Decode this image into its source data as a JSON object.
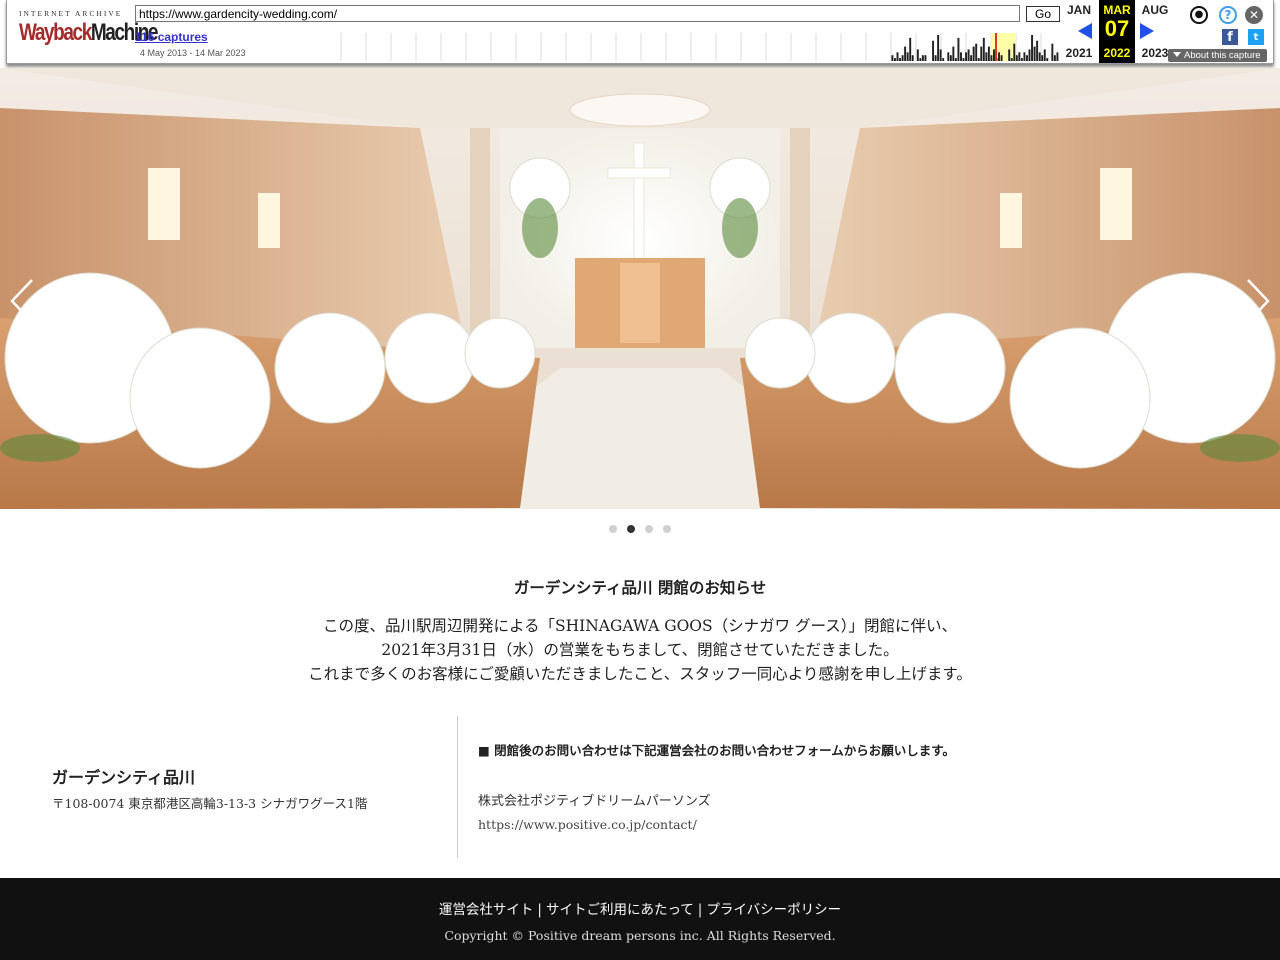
{
  "wayback": {
    "logo_top": "INTERNET ARCHIVE",
    "logo_wayback": "Wayback",
    "logo_machine": "Machine",
    "url": "https://www.gardencity-wedding.com/",
    "go_label": "Go",
    "captures": "116 captures",
    "range": "4 May 2013 - 14 Mar 2023",
    "prev": {
      "month": "JAN",
      "year": "2021"
    },
    "current": {
      "month": "MAR",
      "day": "07",
      "year": "2022"
    },
    "next": {
      "month": "AUG",
      "year": "2023"
    },
    "about": "About this capture",
    "sparkline": [
      0,
      0,
      0,
      0,
      0,
      0,
      0,
      0,
      0,
      0,
      0,
      0,
      0,
      0,
      0,
      0,
      0,
      0,
      0,
      0,
      0,
      0,
      0,
      0,
      0,
      0,
      0,
      0,
      0,
      0,
      0,
      0,
      0,
      0,
      0,
      0,
      0,
      0,
      0,
      0,
      0,
      0,
      0,
      0,
      0,
      0,
      0,
      0,
      0,
      0,
      0,
      0,
      0,
      0,
      0,
      0,
      0,
      0,
      0,
      0,
      0,
      0,
      0,
      0,
      0,
      0,
      0,
      0,
      0,
      0,
      0,
      0,
      0,
      0,
      0,
      0,
      0,
      0,
      0,
      0,
      0,
      0,
      0,
      0,
      0,
      0,
      0,
      0,
      0,
      0,
      0,
      0,
      0,
      0,
      0,
      0,
      0,
      0,
      0,
      0,
      0,
      0,
      0,
      0,
      0,
      0,
      0,
      0,
      0,
      0,
      0,
      0,
      0,
      0,
      0,
      0,
      0,
      0,
      0,
      0,
      0,
      0,
      0,
      0,
      0,
      0,
      0,
      0,
      0,
      0,
      0,
      0,
      0,
      0,
      0,
      0,
      0,
      0,
      0,
      0,
      0,
      0,
      0,
      0,
      0,
      0,
      0,
      0,
      0,
      0,
      0,
      0,
      0,
      0,
      0,
      0,
      0,
      0,
      0,
      0,
      0,
      0,
      0,
      0,
      0,
      0,
      0,
      0,
      0,
      0,
      0,
      0,
      0,
      0,
      0,
      0,
      0,
      0,
      0,
      0,
      0,
      0,
      0,
      0,
      0,
      0,
      0,
      0,
      0,
      0,
      0,
      0,
      0,
      0,
      0,
      0,
      0,
      0,
      0,
      0,
      0,
      0,
      0,
      0,
      0,
      0,
      0,
      0,
      0,
      0,
      0,
      0,
      0,
      0,
      0,
      0,
      0,
      0,
      0,
      0,
      2,
      1,
      3,
      1,
      2,
      5,
      3,
      8,
      2,
      0,
      4,
      1,
      2,
      2,
      0,
      0,
      7,
      2,
      9,
      4,
      1,
      0,
      3,
      2,
      5,
      1,
      8,
      3,
      1,
      3,
      4,
      2,
      5,
      6,
      1,
      5,
      8,
      3,
      5,
      2,
      4,
      1,
      3,
      2,
      0,
      0,
      4,
      1,
      6,
      2,
      3,
      1,
      3,
      2,
      4,
      9,
      5,
      7,
      3,
      2,
      4,
      1,
      0,
      6,
      2,
      3
    ]
  },
  "slider": {
    "total": 4,
    "active": 1
  },
  "notice": {
    "title": "ガーデンシティ品川 閉館のお知らせ",
    "lines": [
      "この度、品川駅周辺開発による「SHINAGAWA GOOS（シナガワ グース）」閉館に伴い、",
      "2021年3月31日（水）の営業をもちまして、閉館させていただきました。",
      "これまで多くのお客様にご愛顧いただきましたこと、スタッフ一同心より感謝を申し上げます。"
    ]
  },
  "venue": {
    "name": "ガーデンシティ品川",
    "address": "〒108-0074 東京都港区高輪3-13-3 シナガワグース1階"
  },
  "contact": {
    "heading": "■ 閉館後のお問い合わせは下記運営会社のお問い合わせフォームからお願いします。",
    "company": "株式会社ポジティブドリームパーソンズ",
    "url": "https://www.positive.co.jp/contact/"
  },
  "footer": {
    "links": [
      "運営会社サイト",
      "サイトご利用にあたって",
      "プライバシーポリシー"
    ],
    "separator": "|",
    "copyright": "Copyright © Positive dream persons inc. All Rights Reserved."
  }
}
